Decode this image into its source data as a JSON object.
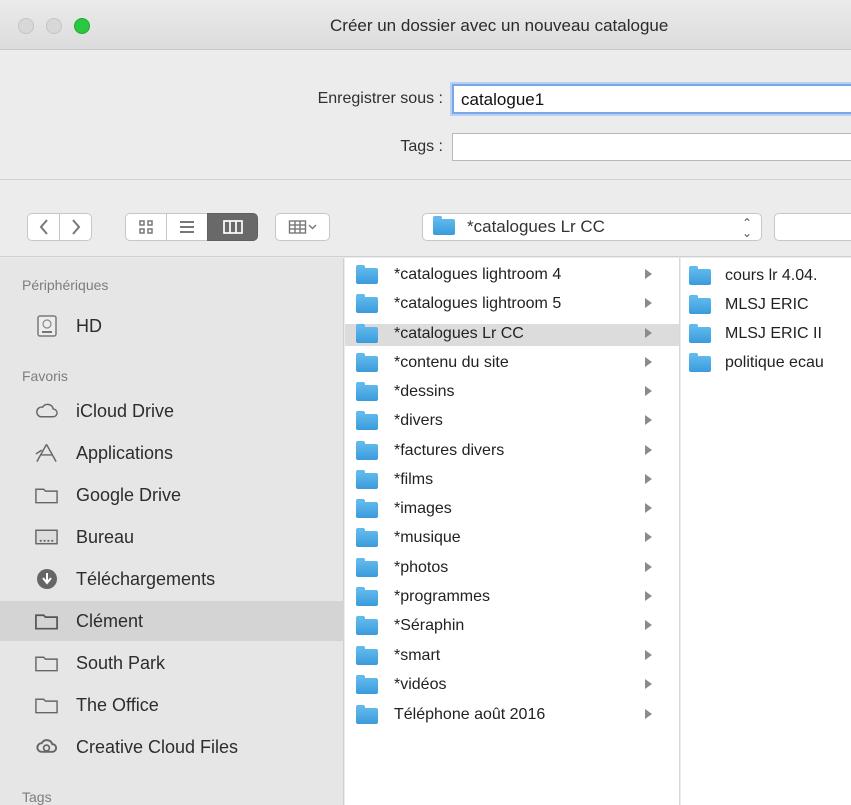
{
  "window": {
    "title": "Créer un dossier avec un nouveau catalogue"
  },
  "save_panel": {
    "save_as_label": "Enregistrer sous :",
    "save_as_value": "catalogue1",
    "tags_label": "Tags :",
    "tags_value": ""
  },
  "toolbar": {
    "current_folder": "*catalogues Lr CC"
  },
  "sidebar": {
    "devices_title": "Périphériques",
    "devices": [
      {
        "label": "HD",
        "icon": "hard-drive-icon"
      }
    ],
    "favorites_title": "Favoris",
    "favorites": [
      {
        "label": "iCloud Drive",
        "icon": "cloud-icon"
      },
      {
        "label": "Applications",
        "icon": "applications-icon"
      },
      {
        "label": "Google Drive",
        "icon": "folder-icon"
      },
      {
        "label": "Bureau",
        "icon": "desktop-icon"
      },
      {
        "label": "Téléchargements",
        "icon": "download-icon"
      },
      {
        "label": "Clément",
        "icon": "folder-icon",
        "selected": true
      },
      {
        "label": "South Park",
        "icon": "folder-icon"
      },
      {
        "label": "The Office",
        "icon": "folder-icon"
      },
      {
        "label": "Creative Cloud Files",
        "icon": "creative-cloud-icon"
      }
    ],
    "tags_title": "Tags"
  },
  "column1": {
    "items": [
      {
        "label": "*catalogues lightroom 4"
      },
      {
        "label": "*catalogues lightroom 5"
      },
      {
        "label": "*catalogues Lr CC",
        "selected": true
      },
      {
        "label": "*contenu du site"
      },
      {
        "label": "*dessins"
      },
      {
        "label": "*divers"
      },
      {
        "label": "*factures divers"
      },
      {
        "label": "*films"
      },
      {
        "label": "*images"
      },
      {
        "label": "*musique"
      },
      {
        "label": "*photos"
      },
      {
        "label": "*programmes"
      },
      {
        "label": "*Séraphin"
      },
      {
        "label": "*smart"
      },
      {
        "label": "*vidéos"
      },
      {
        "label": "Téléphone août 2016"
      }
    ]
  },
  "column2": {
    "items": [
      {
        "label": "cours lr 4.04."
      },
      {
        "label": "MLSJ ERIC"
      },
      {
        "label": "MLSJ ERIC II"
      },
      {
        "label": "politique ecau"
      }
    ]
  },
  "colors": {
    "selected_sidebar": "#d4d4d4",
    "selected_row": "#dcdcdc",
    "folder_blue": "#3a9bdc",
    "focus_ring": "#7aa7e5"
  }
}
